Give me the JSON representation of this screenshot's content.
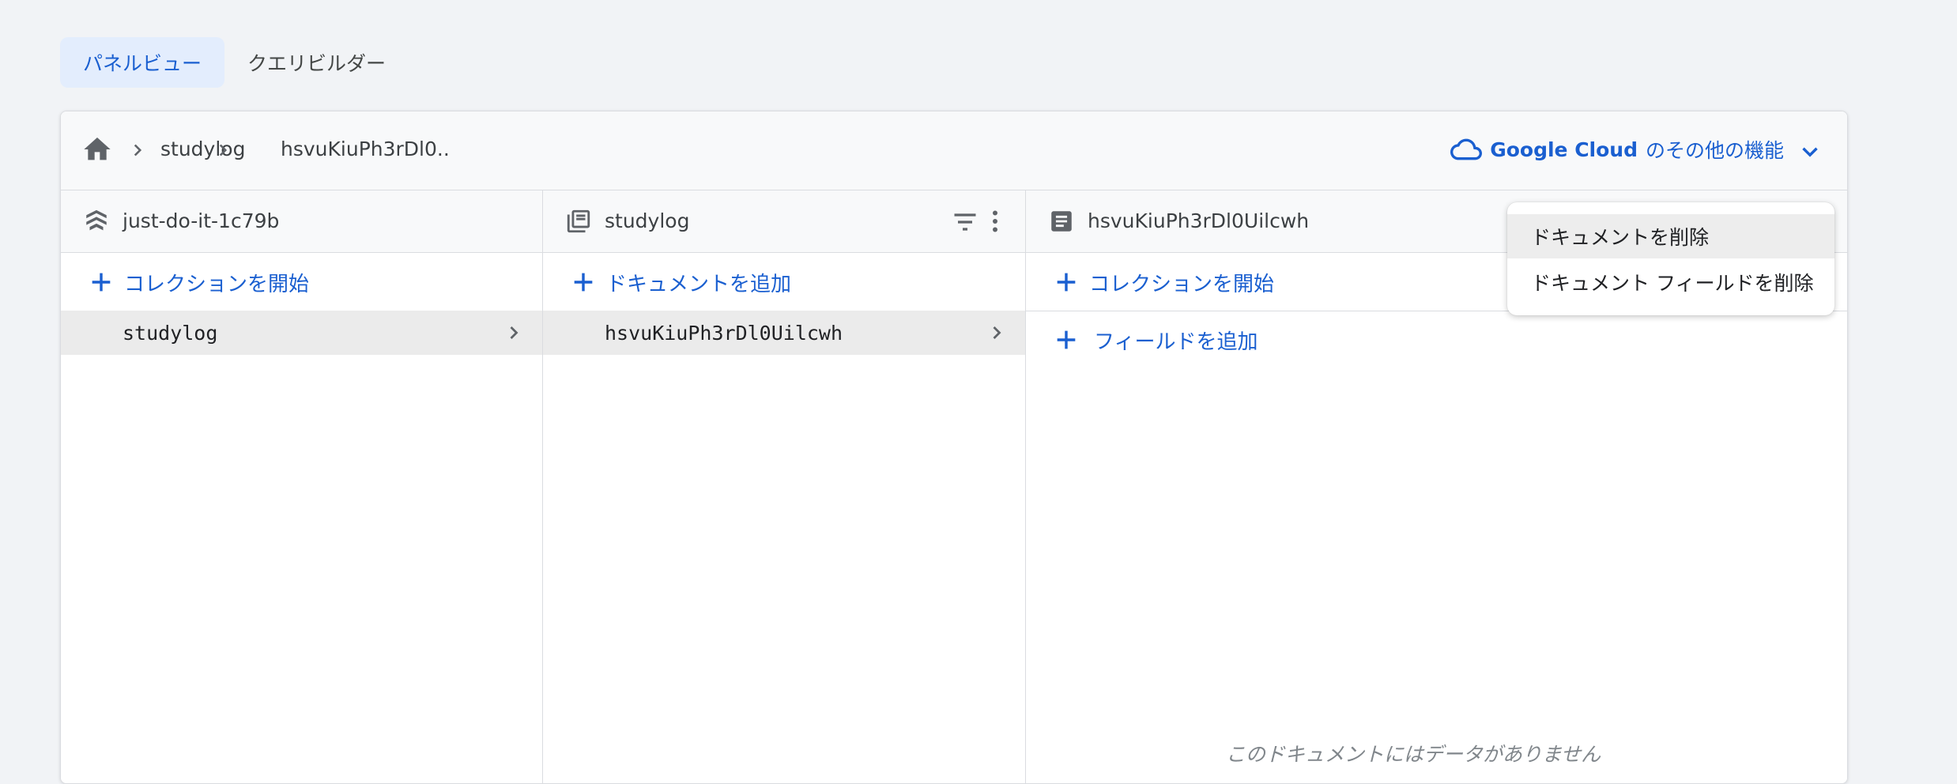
{
  "tabs": [
    {
      "label": "パネルビュー",
      "active": true
    },
    {
      "label": "クエリビルダー",
      "active": false
    }
  ],
  "breadcrumb": {
    "home_icon": "home-icon",
    "items": [
      "studylog",
      "hsvuKiuPh3rDl0.."
    ]
  },
  "google_cloud": {
    "brand": "Google Cloud",
    "suffix": "のその他の機能",
    "icon": "cloud-icon"
  },
  "columns": {
    "database": {
      "title": "just-do-it-1c79b",
      "icon": "firestore-icon",
      "add_label": "コレクションを開始",
      "items": [
        "studylog"
      ]
    },
    "collection": {
      "title": "studylog",
      "icon": "collection-icon",
      "add_label": "ドキュメントを追加",
      "items": [
        "hsvuKiuPh3rDl0Uilcwh"
      ]
    },
    "document": {
      "title": "hsvuKiuPh3rDl0Uilcwh",
      "icon": "document-icon",
      "add_collection_label": "コレクションを開始",
      "add_field_label": "フィールドを追加",
      "empty_message": "このドキュメントにはデータがありません"
    }
  },
  "context_menu": {
    "items": [
      "ドキュメントを削除",
      "ドキュメント フィールドを削除"
    ]
  },
  "colors": {
    "accent": "#1a5fd0",
    "active_tab_bg": "#e3edfd",
    "selected_row_bg": "#ebebeb"
  }
}
